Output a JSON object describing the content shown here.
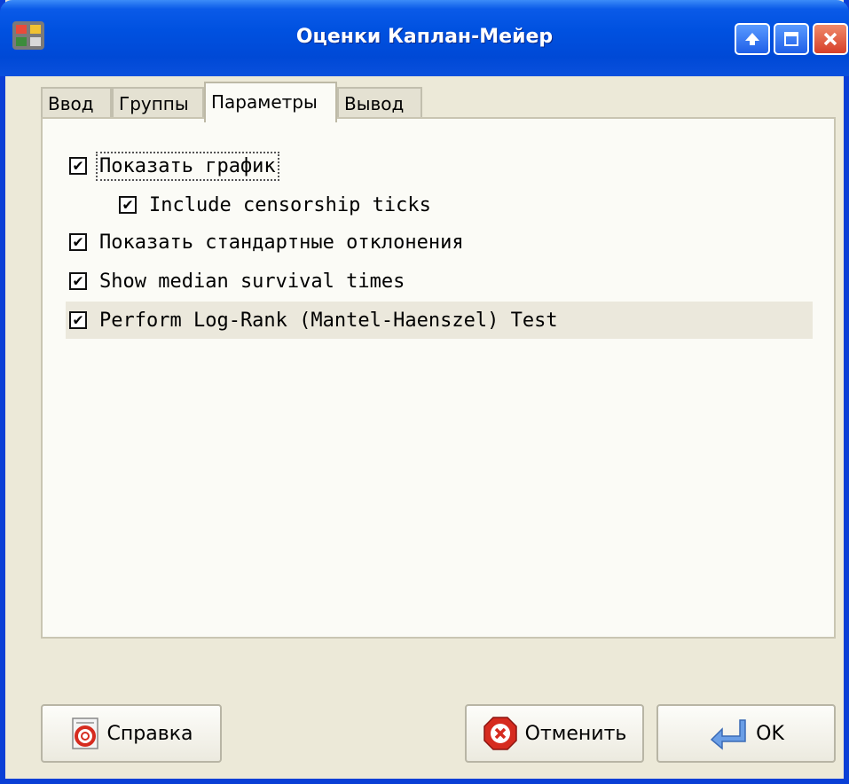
{
  "window": {
    "title": "Оценки Каплан-Мейер"
  },
  "tabs": [
    {
      "label": "Ввод",
      "active": false
    },
    {
      "label": "Группы",
      "active": false
    },
    {
      "label": "Параметры",
      "active": true
    },
    {
      "label": "Вывод",
      "active": false
    }
  ],
  "options": [
    {
      "label": "Показать график",
      "checked": true,
      "focused": true
    },
    {
      "label": "Include censorship ticks",
      "checked": true
    },
    {
      "label": "Показать стандартные отклонения",
      "checked": true
    },
    {
      "label": "Show median survival times",
      "checked": true
    },
    {
      "label": "Perform Log-Rank (Mantel-Haenszel) Test",
      "checked": true,
      "highlighted": true
    }
  ],
  "buttons": {
    "help": "Справка",
    "cancel": "Отменить",
    "ok": "OK"
  },
  "icons": {
    "help": "lifebuoy-icon",
    "cancel": "stop-sign-icon",
    "ok": "enter-arrow-icon"
  },
  "colors": {
    "titlebar": "#0051e0",
    "panel": "#fbfbf6",
    "window_bg": "#ece9d8",
    "cancel_icon": "#d62b1f"
  }
}
